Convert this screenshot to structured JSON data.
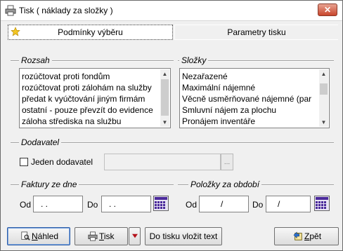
{
  "window": {
    "title": "Tisk ( náklady za složky )",
    "close_label": "✕"
  },
  "tabs": [
    {
      "label": "Podmínky výběru",
      "active": true
    },
    {
      "label": "Parametry tisku",
      "active": false
    }
  ],
  "rozsah": {
    "label": "Rozsah",
    "items": [
      "rozúčtovat proti fondům",
      "rozúčtovat proti zálohám na služby",
      "předat k vyúčtování jiným firmám",
      "ostatní - pouze převzít do evidence",
      "záloha střediska na službu"
    ]
  },
  "slozky": {
    "label": "Složky",
    "items": [
      "Nezařazené",
      "Maximální nájemné",
      "Věcně usměrňované nájemné (par",
      "Smluvní nájem za plochu",
      "Pronájem inventáře"
    ]
  },
  "dodavatel": {
    "label": "Dodavatel",
    "checkbox_label": "Jeden dodavatel",
    "field_value": "",
    "ellipsis": "..."
  },
  "faktury": {
    "label": "Faktury ze dne",
    "od_label": "Od",
    "do_label": "Do",
    "od_value": ". .",
    "do_value": ". ."
  },
  "polozky": {
    "label": "Položky za období",
    "od_label": "Od",
    "do_label": "Do",
    "od_value": "/",
    "do_value": "/"
  },
  "footer": {
    "nahled_first": "N",
    "nahled_rest": "áhled",
    "tisk_first": "T",
    "tisk_rest": "isk",
    "vlozit_label": "Do tisku vložit text",
    "zpet_first": "Z",
    "zpet_rest": "pět"
  },
  "colors": {
    "accent_red": "#c8452b",
    "calendar_purple": "#4b2a9b",
    "dropdown_red": "#b5121b"
  }
}
